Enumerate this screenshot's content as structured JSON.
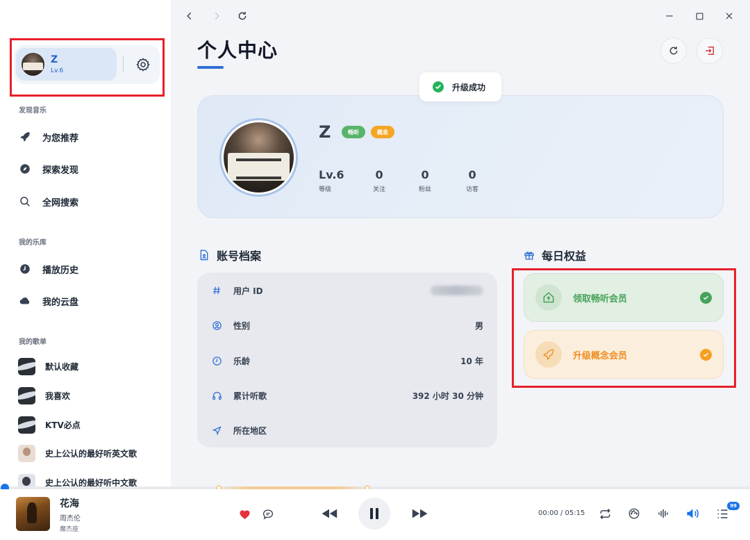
{
  "sidebar": {
    "user": {
      "name": "Z",
      "level": "Lv.6"
    },
    "sections": [
      {
        "title": "发现音乐",
        "items": [
          {
            "label": "为您推荐",
            "icon": "rocket-icon"
          },
          {
            "label": "探索发现",
            "icon": "compass-icon"
          },
          {
            "label": "全网搜索",
            "icon": "search-icon"
          }
        ]
      },
      {
        "title": "我的乐库",
        "items": [
          {
            "label": "播放历史",
            "icon": "clock-icon"
          },
          {
            "label": "我的云盘",
            "icon": "cloud-icon"
          }
        ]
      },
      {
        "title": "我的歌单",
        "items": [
          {
            "label": "默认收藏"
          },
          {
            "label": "我喜欢"
          },
          {
            "label": "KTV必点"
          },
          {
            "label": "史上公认的最好听英文歌"
          },
          {
            "label": "史上公认的最好听中文歌"
          }
        ]
      }
    ]
  },
  "main": {
    "page_title": "个人中心",
    "toast": "升级成功",
    "profile": {
      "name": "Z",
      "badges": [
        "畅听",
        "概念"
      ],
      "stats": [
        {
          "value": "Lv.6",
          "label": "等级"
        },
        {
          "value": "0",
          "label": "关注"
        },
        {
          "value": "0",
          "label": "粉丝"
        },
        {
          "value": "0",
          "label": "访客"
        }
      ]
    },
    "account": {
      "title": "账号档案",
      "rows": [
        {
          "label": "用户 ID",
          "value": "",
          "icon": "hash-icon"
        },
        {
          "label": "性别",
          "value": "男",
          "icon": "user-circle-icon"
        },
        {
          "label": "乐龄",
          "value": "10 年",
          "icon": "clock-icon"
        },
        {
          "label": "累计听歌",
          "value": "392 小时 30 分钟",
          "icon": "headphones-icon"
        },
        {
          "label": "所在地区",
          "value": "",
          "icon": "location-arrow-icon"
        }
      ]
    },
    "benefits": {
      "title": "每日权益",
      "items": [
        {
          "label": "领取畅听会员",
          "icon": "home-upgrade-icon"
        },
        {
          "label": "升级概念会员",
          "icon": "rocket-icon"
        }
      ]
    }
  },
  "player": {
    "title": "花海",
    "artist": "周杰伦",
    "album": "魔杰座",
    "time": "00:00 / 05:15",
    "queue_count": "99",
    "progress": 0.0
  },
  "colors": {
    "accent": "#2f6fd6",
    "highlight_box": "#e8202a",
    "success": "#22b35a",
    "benefit_green": "#46a35a",
    "benefit_orange": "#ef8d1f"
  }
}
